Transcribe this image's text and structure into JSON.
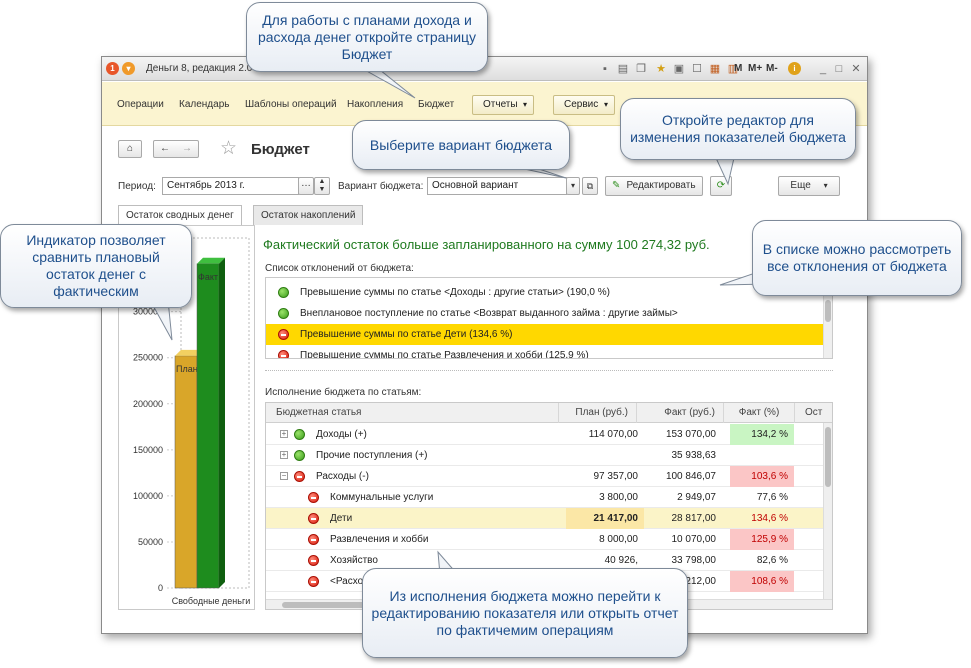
{
  "window": {
    "title": "Деньги 8, редакция 2.0 / А",
    "toolbar_labels": [
      "M",
      "M+",
      "M-"
    ]
  },
  "menu": {
    "items": [
      "Операции",
      "Календарь",
      "Шаблоны операций",
      "Накопления",
      "Бюджет"
    ],
    "dropdowns": [
      "Отчеты",
      "Сервис"
    ]
  },
  "header": {
    "title": "Бюджет",
    "home_icon": "home-icon",
    "back_icon": "arrow-left-icon",
    "forward_icon": "arrow-right-icon",
    "star_icon": "star-icon"
  },
  "filters": {
    "period_label": "Период:",
    "period_value": "Сентябрь 2013 г.",
    "variant_label": "Вариант бюджета:",
    "variant_value": "Основной вариант",
    "edit_button": "Редактировать",
    "more_button": "Еще"
  },
  "tabs": [
    "Остаток сводных денег",
    "Остаток накоплений"
  ],
  "summary": "Фактический остаток больше запланированного на сумму 100 274,32 руб.",
  "deviations": {
    "label": "Список отклонений от бюджета:",
    "items": [
      {
        "status": "green",
        "text": "Превышение суммы по статье <Доходы : другие статьи> (190,0 %)"
      },
      {
        "status": "green",
        "text": "Внеплановое поступление по статье <Возврат выданного займа : другие займы>"
      },
      {
        "status": "red",
        "text": "Превышение суммы по статье Дети (134,6 %)",
        "selected": true
      },
      {
        "status": "red",
        "text": "Превышение суммы по статье Развлечения и хобби (125,9 %)"
      }
    ]
  },
  "execution": {
    "label": "Исполнение бюджета по статьям:",
    "columns": [
      "Бюджетная статья",
      "План (руб.)",
      "Факт (руб.)",
      "Факт (%)",
      "Ост"
    ],
    "rows": [
      {
        "tree": "+",
        "status": "green",
        "name": "Доходы (+)",
        "plan": "114 070,00",
        "fact": "153 070,00",
        "pct": "134,2 %",
        "pct_style": "good",
        "level": 0
      },
      {
        "tree": "+",
        "status": "green",
        "name": "Прочие поступления (+)",
        "plan": "",
        "fact": "35 938,63",
        "pct": "",
        "pct_style": "",
        "level": 0
      },
      {
        "tree": "−",
        "status": "red",
        "name": "Расходы (-)",
        "plan": "97 357,00",
        "fact": "100 846,07",
        "pct": "103,6 %",
        "pct_style": "bad",
        "level": 0
      },
      {
        "tree": "",
        "status": "red-warn",
        "name": "Коммунальные услуги",
        "plan": "3 800,00",
        "fact": "2 949,07",
        "pct": "77,6 %",
        "pct_style": "",
        "level": 1
      },
      {
        "tree": "",
        "status": "red",
        "name": "Дети",
        "plan": "21 417,00",
        "fact": "28 817,00",
        "pct": "134,6 %",
        "pct_style": "bad-text",
        "level": 1,
        "selected": true
      },
      {
        "tree": "",
        "status": "red",
        "name": "Развлечения и хобби",
        "plan": "8 000,00",
        "fact": "10 070,00",
        "pct": "125,9 %",
        "pct_style": "bad",
        "level": 1
      },
      {
        "tree": "",
        "status": "red",
        "name": "Хозяйство",
        "plan": "40 926,",
        "fact": "33 798,00",
        "pct": "82,6 %",
        "pct_style": "",
        "level": 1
      },
      {
        "tree": "",
        "status": "red",
        "name": "<Расхо",
        "plan": "",
        "fact": "212,00",
        "pct": "108,6 %",
        "pct_style": "bad",
        "level": 1
      }
    ]
  },
  "chart_data": {
    "type": "bar",
    "categories": [
      "Свободные деньги"
    ],
    "series": [
      {
        "name": "План",
        "values": [
          252000
        ],
        "color": "#d9a629"
      },
      {
        "name": "Факт",
        "values": [
          352000
        ],
        "color": "#1e8c1e"
      }
    ],
    "yticks": [
      "300000",
      "250000",
      "200000",
      "150000",
      "100000",
      "50000",
      "0"
    ],
    "ytick_values": [
      300000,
      250000,
      200000,
      150000,
      100000,
      50000,
      0
    ],
    "ylim": [
      0,
      380000
    ],
    "xlabel": "Свободные деньги",
    "bar_labels": [
      "План",
      "Факт"
    ]
  },
  "callouts": [
    {
      "text": "Для работы с планами дохода и расхода денег откройте страницу Бюджет"
    },
    {
      "text": "Откройте редактор для изменения показателей бюджета"
    },
    {
      "text": "Выберите вариант бюджета"
    },
    {
      "text": "В списке можно рассмотреть все отклонения от бюджета"
    },
    {
      "text": "Индикатор позволяет сравнить плановый остаток денег с фактическим"
    },
    {
      "text": "Из исполнения бюджета можно перейти к редактированию показателя или открыть отчет по фактичемим операциям"
    }
  ]
}
